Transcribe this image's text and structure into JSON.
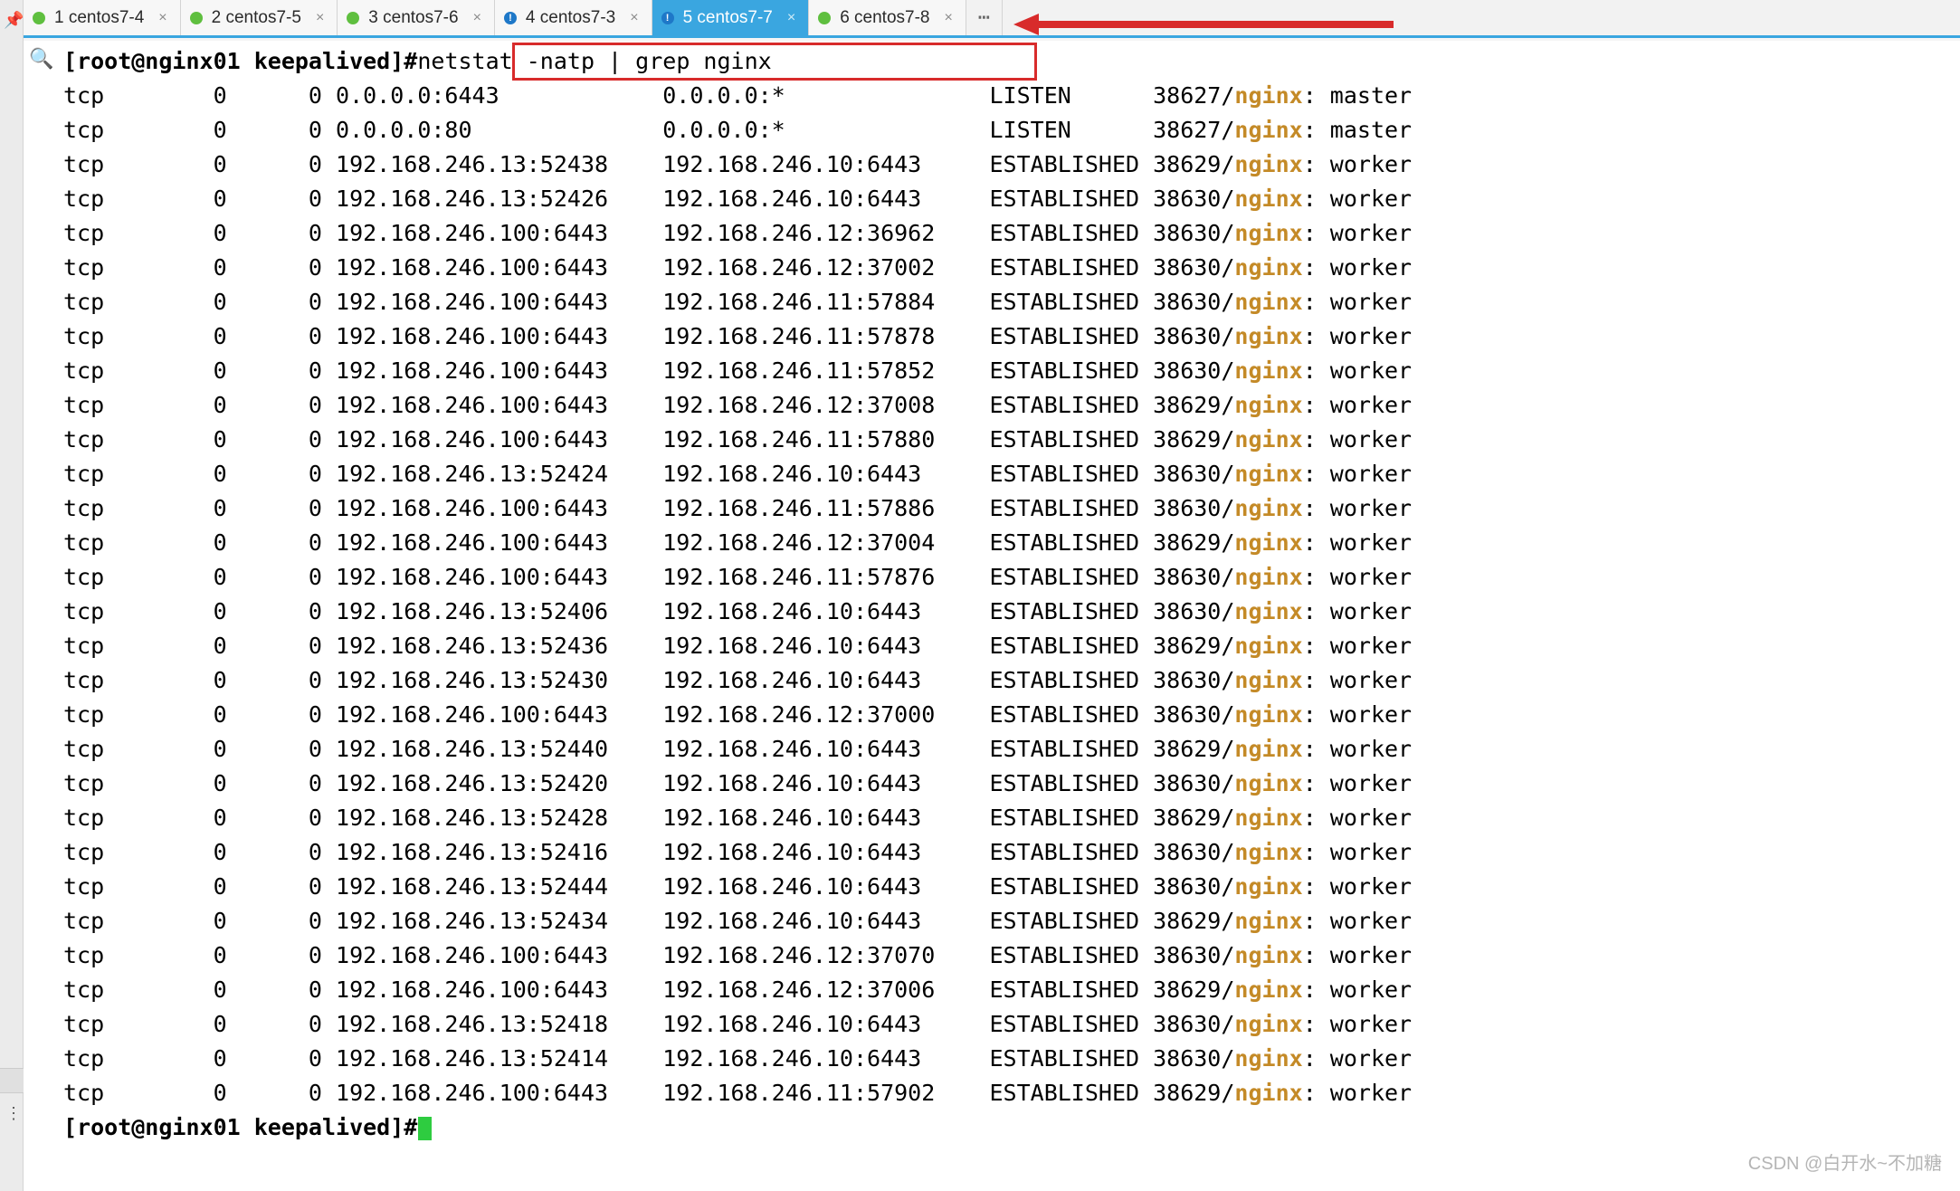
{
  "tabs": [
    {
      "num": "1",
      "label": "centos7-4",
      "dot": "green",
      "active": false
    },
    {
      "num": "2",
      "label": "centos7-5",
      "dot": "green",
      "active": false
    },
    {
      "num": "3",
      "label": "centos7-6",
      "dot": "green",
      "active": false
    },
    {
      "num": "4",
      "label": "centos7-3",
      "dot": "blue",
      "active": false
    },
    {
      "num": "5",
      "label": "centos7-7",
      "dot": "blue",
      "active": true
    },
    {
      "num": "6",
      "label": "centos7-8",
      "dot": "green",
      "active": false
    }
  ],
  "prompt": {
    "user": "root",
    "host": "nginx01",
    "dir": "keepalived",
    "hash": "#",
    "full": "[root@nginx01 keepalived]#"
  },
  "command": "netstat -natp | grep nginx",
  "netstat": [
    {
      "proto": "tcp",
      "recvq": "0",
      "sendq": "0",
      "local": "0.0.0.0:6443",
      "foreign": "0.0.0.0:*",
      "state": "LISTEN",
      "pid": "38627",
      "prog": "nginx",
      "role": "master"
    },
    {
      "proto": "tcp",
      "recvq": "0",
      "sendq": "0",
      "local": "0.0.0.0:80",
      "foreign": "0.0.0.0:*",
      "state": "LISTEN",
      "pid": "38627",
      "prog": "nginx",
      "role": "master"
    },
    {
      "proto": "tcp",
      "recvq": "0",
      "sendq": "0",
      "local": "192.168.246.13:52438",
      "foreign": "192.168.246.10:6443",
      "state": "ESTABLISHED",
      "pid": "38629",
      "prog": "nginx",
      "role": "worker"
    },
    {
      "proto": "tcp",
      "recvq": "0",
      "sendq": "0",
      "local": "192.168.246.13:52426",
      "foreign": "192.168.246.10:6443",
      "state": "ESTABLISHED",
      "pid": "38630",
      "prog": "nginx",
      "role": "worker"
    },
    {
      "proto": "tcp",
      "recvq": "0",
      "sendq": "0",
      "local": "192.168.246.100:6443",
      "foreign": "192.168.246.12:36962",
      "state": "ESTABLISHED",
      "pid": "38630",
      "prog": "nginx",
      "role": "worker"
    },
    {
      "proto": "tcp",
      "recvq": "0",
      "sendq": "0",
      "local": "192.168.246.100:6443",
      "foreign": "192.168.246.12:37002",
      "state": "ESTABLISHED",
      "pid": "38630",
      "prog": "nginx",
      "role": "worker"
    },
    {
      "proto": "tcp",
      "recvq": "0",
      "sendq": "0",
      "local": "192.168.246.100:6443",
      "foreign": "192.168.246.11:57884",
      "state": "ESTABLISHED",
      "pid": "38630",
      "prog": "nginx",
      "role": "worker"
    },
    {
      "proto": "tcp",
      "recvq": "0",
      "sendq": "0",
      "local": "192.168.246.100:6443",
      "foreign": "192.168.246.11:57878",
      "state": "ESTABLISHED",
      "pid": "38630",
      "prog": "nginx",
      "role": "worker"
    },
    {
      "proto": "tcp",
      "recvq": "0",
      "sendq": "0",
      "local": "192.168.246.100:6443",
      "foreign": "192.168.246.11:57852",
      "state": "ESTABLISHED",
      "pid": "38630",
      "prog": "nginx",
      "role": "worker"
    },
    {
      "proto": "tcp",
      "recvq": "0",
      "sendq": "0",
      "local": "192.168.246.100:6443",
      "foreign": "192.168.246.12:37008",
      "state": "ESTABLISHED",
      "pid": "38629",
      "prog": "nginx",
      "role": "worker"
    },
    {
      "proto": "tcp",
      "recvq": "0",
      "sendq": "0",
      "local": "192.168.246.100:6443",
      "foreign": "192.168.246.11:57880",
      "state": "ESTABLISHED",
      "pid": "38629",
      "prog": "nginx",
      "role": "worker"
    },
    {
      "proto": "tcp",
      "recvq": "0",
      "sendq": "0",
      "local": "192.168.246.13:52424",
      "foreign": "192.168.246.10:6443",
      "state": "ESTABLISHED",
      "pid": "38630",
      "prog": "nginx",
      "role": "worker"
    },
    {
      "proto": "tcp",
      "recvq": "0",
      "sendq": "0",
      "local": "192.168.246.100:6443",
      "foreign": "192.168.246.11:57886",
      "state": "ESTABLISHED",
      "pid": "38630",
      "prog": "nginx",
      "role": "worker"
    },
    {
      "proto": "tcp",
      "recvq": "0",
      "sendq": "0",
      "local": "192.168.246.100:6443",
      "foreign": "192.168.246.12:37004",
      "state": "ESTABLISHED",
      "pid": "38629",
      "prog": "nginx",
      "role": "worker"
    },
    {
      "proto": "tcp",
      "recvq": "0",
      "sendq": "0",
      "local": "192.168.246.100:6443",
      "foreign": "192.168.246.11:57876",
      "state": "ESTABLISHED",
      "pid": "38630",
      "prog": "nginx",
      "role": "worker"
    },
    {
      "proto": "tcp",
      "recvq": "0",
      "sendq": "0",
      "local": "192.168.246.13:52406",
      "foreign": "192.168.246.10:6443",
      "state": "ESTABLISHED",
      "pid": "38630",
      "prog": "nginx",
      "role": "worker"
    },
    {
      "proto": "tcp",
      "recvq": "0",
      "sendq": "0",
      "local": "192.168.246.13:52436",
      "foreign": "192.168.246.10:6443",
      "state": "ESTABLISHED",
      "pid": "38629",
      "prog": "nginx",
      "role": "worker"
    },
    {
      "proto": "tcp",
      "recvq": "0",
      "sendq": "0",
      "local": "192.168.246.13:52430",
      "foreign": "192.168.246.10:6443",
      "state": "ESTABLISHED",
      "pid": "38630",
      "prog": "nginx",
      "role": "worker"
    },
    {
      "proto": "tcp",
      "recvq": "0",
      "sendq": "0",
      "local": "192.168.246.100:6443",
      "foreign": "192.168.246.12:37000",
      "state": "ESTABLISHED",
      "pid": "38630",
      "prog": "nginx",
      "role": "worker"
    },
    {
      "proto": "tcp",
      "recvq": "0",
      "sendq": "0",
      "local": "192.168.246.13:52440",
      "foreign": "192.168.246.10:6443",
      "state": "ESTABLISHED",
      "pid": "38629",
      "prog": "nginx",
      "role": "worker"
    },
    {
      "proto": "tcp",
      "recvq": "0",
      "sendq": "0",
      "local": "192.168.246.13:52420",
      "foreign": "192.168.246.10:6443",
      "state": "ESTABLISHED",
      "pid": "38630",
      "prog": "nginx",
      "role": "worker"
    },
    {
      "proto": "tcp",
      "recvq": "0",
      "sendq": "0",
      "local": "192.168.246.13:52428",
      "foreign": "192.168.246.10:6443",
      "state": "ESTABLISHED",
      "pid": "38629",
      "prog": "nginx",
      "role": "worker"
    },
    {
      "proto": "tcp",
      "recvq": "0",
      "sendq": "0",
      "local": "192.168.246.13:52416",
      "foreign": "192.168.246.10:6443",
      "state": "ESTABLISHED",
      "pid": "38630",
      "prog": "nginx",
      "role": "worker"
    },
    {
      "proto": "tcp",
      "recvq": "0",
      "sendq": "0",
      "local": "192.168.246.13:52444",
      "foreign": "192.168.246.10:6443",
      "state": "ESTABLISHED",
      "pid": "38630",
      "prog": "nginx",
      "role": "worker"
    },
    {
      "proto": "tcp",
      "recvq": "0",
      "sendq": "0",
      "local": "192.168.246.13:52434",
      "foreign": "192.168.246.10:6443",
      "state": "ESTABLISHED",
      "pid": "38629",
      "prog": "nginx",
      "role": "worker"
    },
    {
      "proto": "tcp",
      "recvq": "0",
      "sendq": "0",
      "local": "192.168.246.100:6443",
      "foreign": "192.168.246.12:37070",
      "state": "ESTABLISHED",
      "pid": "38630",
      "prog": "nginx",
      "role": "worker"
    },
    {
      "proto": "tcp",
      "recvq": "0",
      "sendq": "0",
      "local": "192.168.246.100:6443",
      "foreign": "192.168.246.12:37006",
      "state": "ESTABLISHED",
      "pid": "38629",
      "prog": "nginx",
      "role": "worker"
    },
    {
      "proto": "tcp",
      "recvq": "0",
      "sendq": "0",
      "local": "192.168.246.13:52418",
      "foreign": "192.168.246.10:6443",
      "state": "ESTABLISHED",
      "pid": "38630",
      "prog": "nginx",
      "role": "worker"
    },
    {
      "proto": "tcp",
      "recvq": "0",
      "sendq": "0",
      "local": "192.168.246.13:52414",
      "foreign": "192.168.246.10:6443",
      "state": "ESTABLISHED",
      "pid": "38630",
      "prog": "nginx",
      "role": "worker"
    },
    {
      "proto": "tcp",
      "recvq": "0",
      "sendq": "0",
      "local": "192.168.246.100:6443",
      "foreign": "192.168.246.11:57902",
      "state": "ESTABLISHED",
      "pid": "38629",
      "prog": "nginx",
      "role": "worker"
    }
  ],
  "watermark": "CSDN @白开水~不加糖"
}
